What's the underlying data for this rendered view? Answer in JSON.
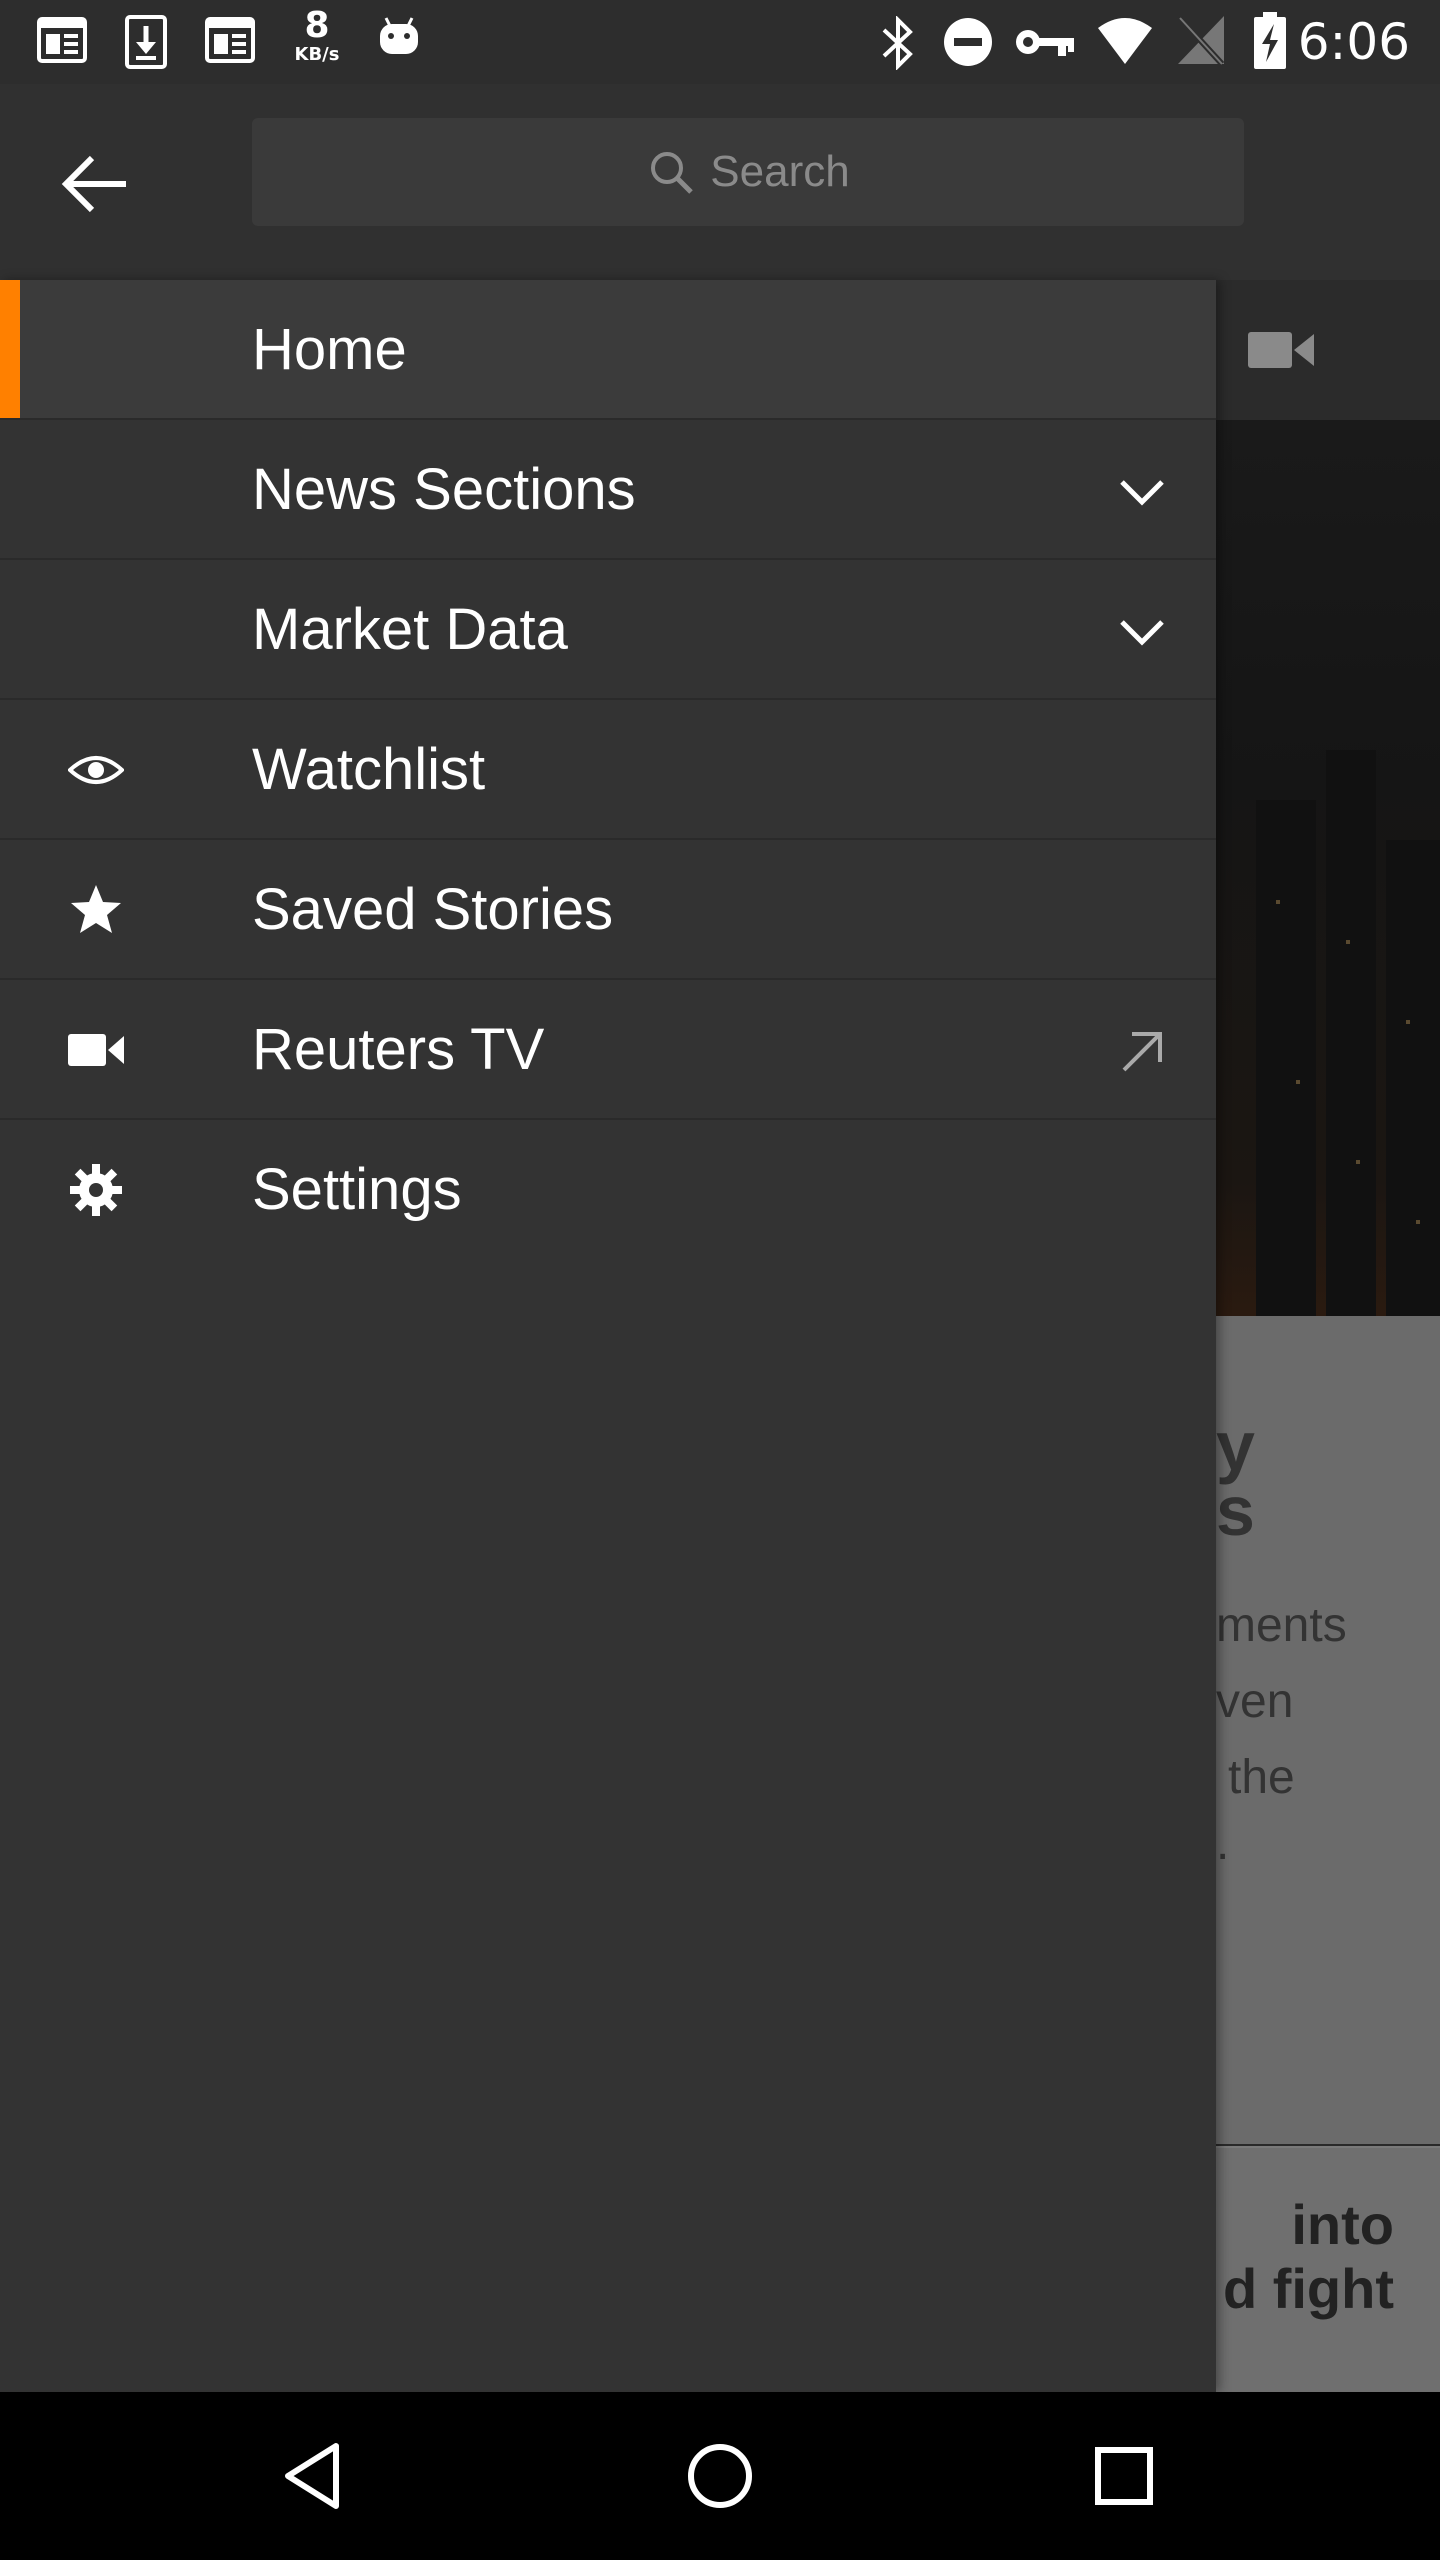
{
  "status_bar": {
    "speed_value": "8",
    "speed_unit": "KB/s",
    "time": "6:06"
  },
  "search": {
    "placeholder": "Search"
  },
  "menu": {
    "items": [
      {
        "label": "Home",
        "icon": "none",
        "active": true
      },
      {
        "label": "News Sections",
        "icon": "chevron-down-icon"
      },
      {
        "label": "Market Data",
        "icon": "chevron-down-icon"
      },
      {
        "label": "Watchlist",
        "icon": "eye-icon"
      },
      {
        "label": "Saved Stories",
        "icon": "star-icon"
      },
      {
        "label": "Reuters TV",
        "icon": "video-camera-icon",
        "trailing_icon": "external-link-arrow-icon"
      },
      {
        "label": "Settings",
        "icon": "gear-icon"
      }
    ]
  },
  "background_content": {
    "card_fragments": [
      "y",
      "s",
      "ments",
      "ven",
      "the",
      "."
    ],
    "card2_fragments": [
      "into",
      "d fight"
    ]
  },
  "colors": {
    "accent": "#ff8000",
    "drawer_bg": "#333333",
    "topbar_bg": "#303030"
  }
}
